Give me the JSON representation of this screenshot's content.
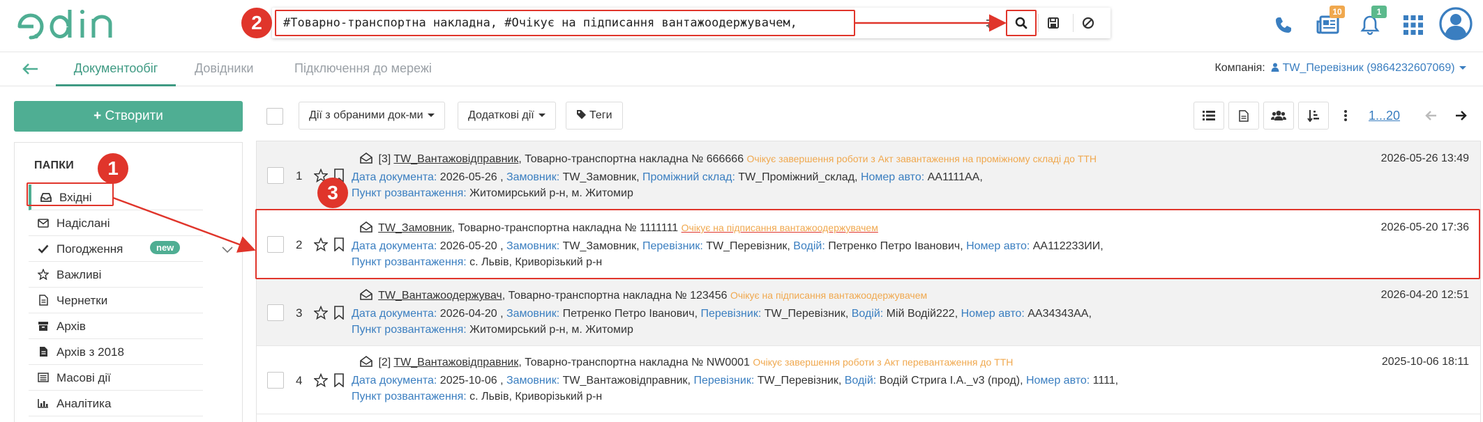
{
  "app": {
    "logo_text": "edin"
  },
  "search": {
    "value": "#Товарно-транспортна накладна, #Очікує на підписання вантажоодержувачем,"
  },
  "badges": {
    "documents_count": "10",
    "notifications_count": "1"
  },
  "nav": {
    "tabs": [
      {
        "label": "Документообіг",
        "active": true
      },
      {
        "label": "Довідники",
        "active": false
      },
      {
        "label": "Підключення до мережі",
        "active": false
      }
    ],
    "company_label": "Компанія:",
    "company_value": "TW_Перевізник (9864232607069)"
  },
  "sidebar": {
    "create_label": "Створити",
    "folders_title": "ПАПКИ",
    "items": [
      {
        "label": "Вхідні",
        "icon": "inbox-icon"
      },
      {
        "label": "Надіслані",
        "icon": "envelope-icon"
      },
      {
        "label": "Погодження",
        "icon": "check-icon",
        "badge": "new"
      },
      {
        "label": "Важливі",
        "icon": "star-icon"
      },
      {
        "label": "Чернетки",
        "icon": "file-icon"
      },
      {
        "label": "Архів",
        "icon": "archive-icon"
      },
      {
        "label": "Архів з 2018",
        "icon": "file-icon"
      },
      {
        "label": "Масові дії",
        "icon": "list-icon"
      },
      {
        "label": "Аналітика",
        "icon": "chart-icon"
      }
    ]
  },
  "toolbar": {
    "actions_label": "Дії з обраними док-ми",
    "extra_label": "Додаткові дії",
    "tags_label": "Теги",
    "pager": "1...20"
  },
  "callouts": {
    "c1": "1",
    "c2": "2",
    "c3": "3"
  },
  "documents": [
    {
      "num": "1",
      "prefix": "[3]",
      "sender": "TW_Вантажовідправник",
      "title": ", Товарно-транспортна накладна № 666666",
      "status": "Очікує завершення роботи з Акт завантаження на проміжному складі до ТТН",
      "date": "2026-05-26 13:49",
      "l2": [
        {
          "label": "Дата документа:",
          "value": " 2026-05-26 , "
        },
        {
          "label": "Замовник:",
          "value": " TW_Замовник, "
        },
        {
          "label": "Проміжний склад:",
          "value": " TW_Проміжний_склад, "
        },
        {
          "label": "Номер авто:",
          "value": " AA1111AA,"
        }
      ],
      "l3": {
        "label": "Пункт розвантаження:",
        "value": " Житомирський р-н, м. Житомир"
      }
    },
    {
      "num": "2",
      "prefix": "",
      "sender": "TW_Замовник",
      "title": ", Товарно-транспортна накладна № 1111111",
      "status": "Очікує на підписання вантажоодержувачем",
      "date": "2026-05-20 17:36",
      "l2": [
        {
          "label": "Дата документа:",
          "value": " 2026-05-20 , "
        },
        {
          "label": "Замовник:",
          "value": " TW_Замовник, "
        },
        {
          "label": "Перевізник:",
          "value": " TW_Перевізник, "
        },
        {
          "label": "Водій:",
          "value": " Петренко Петро Іванович, "
        },
        {
          "label": "Номер авто:",
          "value": " AA112233ИИ,"
        }
      ],
      "l3": {
        "label": "Пункт розвантаження:",
        "value": " с. Львів, Криворізький р-н"
      }
    },
    {
      "num": "3",
      "prefix": "",
      "sender": "TW_Вантажоодержувач",
      "title": ", Товарно-транспортна накладна № 123456",
      "status": "Очікує на підписання вантажоодержувачем",
      "date": "2026-04-20 12:51",
      "l2": [
        {
          "label": "Дата документа:",
          "value": " 2026-04-20 , "
        },
        {
          "label": "Замовник:",
          "value": " Петренко Петро Іванович, "
        },
        {
          "label": "Перевізник:",
          "value": " TW_Перевізник, "
        },
        {
          "label": "Водій:",
          "value": " Мій Водій222, "
        },
        {
          "label": "Номер авто:",
          "value": " AA34343AA,"
        }
      ],
      "l3": {
        "label": "Пункт розвантаження:",
        "value": " Житомирський р-н, м. Житомир"
      }
    },
    {
      "num": "4",
      "prefix": "[2]",
      "sender": "TW_Вантажовідправник",
      "title": ", Товарно-транспортна накладна № NW0001",
      "status": "Очікує завершення роботи з Акт перевантаження до ТТН",
      "date": "2025-10-06 18:11",
      "l2": [
        {
          "label": "Дата документа:",
          "value": " 2025-10-06 , "
        },
        {
          "label": "Замовник:",
          "value": " TW_Вантажовідправник, "
        },
        {
          "label": "Перевізник:",
          "value": " TW_Перевізник, "
        },
        {
          "label": "Водій:",
          "value": " Водій Стрига І.А._v3 (прод), "
        },
        {
          "label": "Номер авто:",
          "value": " 1111,"
        }
      ],
      "l3": {
        "label": "Пункт розвантаження:",
        "value": " с. Львів, Криворізький р-н"
      }
    }
  ],
  "colors": {
    "brand": "#4fae93",
    "link": "#3a7ec0",
    "status": "#f0a84e",
    "annotation": "#e0352b"
  }
}
